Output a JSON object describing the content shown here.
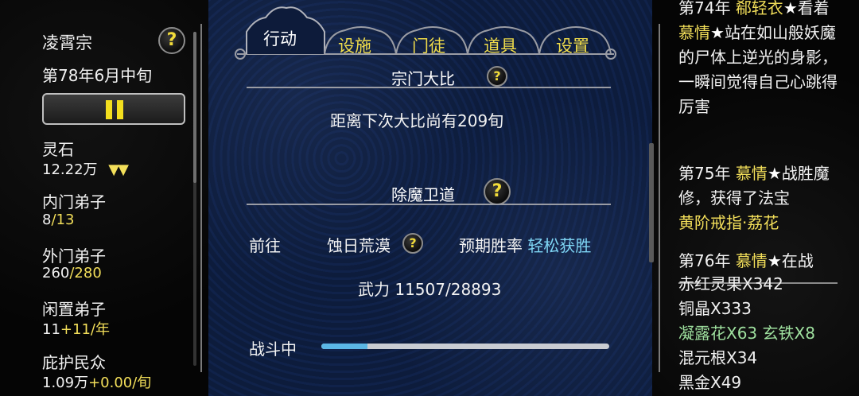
{
  "sect": {
    "name": "凌霄宗",
    "date": "第78年6月中旬"
  },
  "resources": [
    {
      "label": "灵石",
      "value": "12.22万",
      "trend": "▼▼"
    },
    {
      "label": "内门弟子",
      "value": "8",
      "max": "/13"
    },
    {
      "label": "外门弟子",
      "value": "260",
      "max": "/280"
    },
    {
      "label": "闲置弟子",
      "value": "11",
      "delta": "+11/年"
    },
    {
      "label": "庇护民众",
      "value": "1.09万",
      "delta": "+0.00/旬"
    }
  ],
  "tabs": [
    {
      "label": "行动",
      "active": true
    },
    {
      "label": "设施",
      "active": false
    },
    {
      "label": "门徒",
      "active": false
    },
    {
      "label": "道具",
      "active": false
    },
    {
      "label": "设置",
      "active": false
    }
  ],
  "tournament": {
    "title": "宗门大比",
    "countdown": "距离下次大比尚有209旬"
  },
  "demon_hunt": {
    "title": "除魔卫道",
    "goto_label": "前往",
    "location": "蚀日荒漠",
    "win_rate_label": "预期胜率",
    "win_rate_value": "轻松获胜",
    "power_text": "武力 11507/28893",
    "status_label": "战斗中",
    "progress": 0.16
  },
  "help_icon_char": "?",
  "log": {
    "entry74_prefix": "第74年",
    "entry74_name1": "郗轻衣",
    "entry74_star1": "★",
    "entry74_verb1": "看着",
    "entry74_name2": "慕情",
    "entry74_star2": "★",
    "entry74_rest": "站在如山般妖魔的尸体上逆光的身影，一瞬间觉得自己心跳得厉害",
    "entry75_prefix": "第75年",
    "entry75_name": "慕情",
    "entry75_star": "★",
    "entry75_rest": "战胜魔修，获得了法宝",
    "entry75_item": "黄阶戒指·荔花",
    "entry76_prefix": "第76年",
    "entry76_name": "慕情",
    "entry76_star": "★",
    "entry76_rest": "在战",
    "items": [
      {
        "text": "赤红灵果X342",
        "color": "white"
      },
      {
        "text": "铜晶X333",
        "color": "white"
      },
      {
        "text": "凝露花X63",
        "color": "green"
      },
      {
        "text": "玄铁X8",
        "color": "green"
      },
      {
        "text": "混元根X34",
        "color": "white"
      },
      {
        "text": "黑金X49",
        "color": "white"
      }
    ]
  }
}
